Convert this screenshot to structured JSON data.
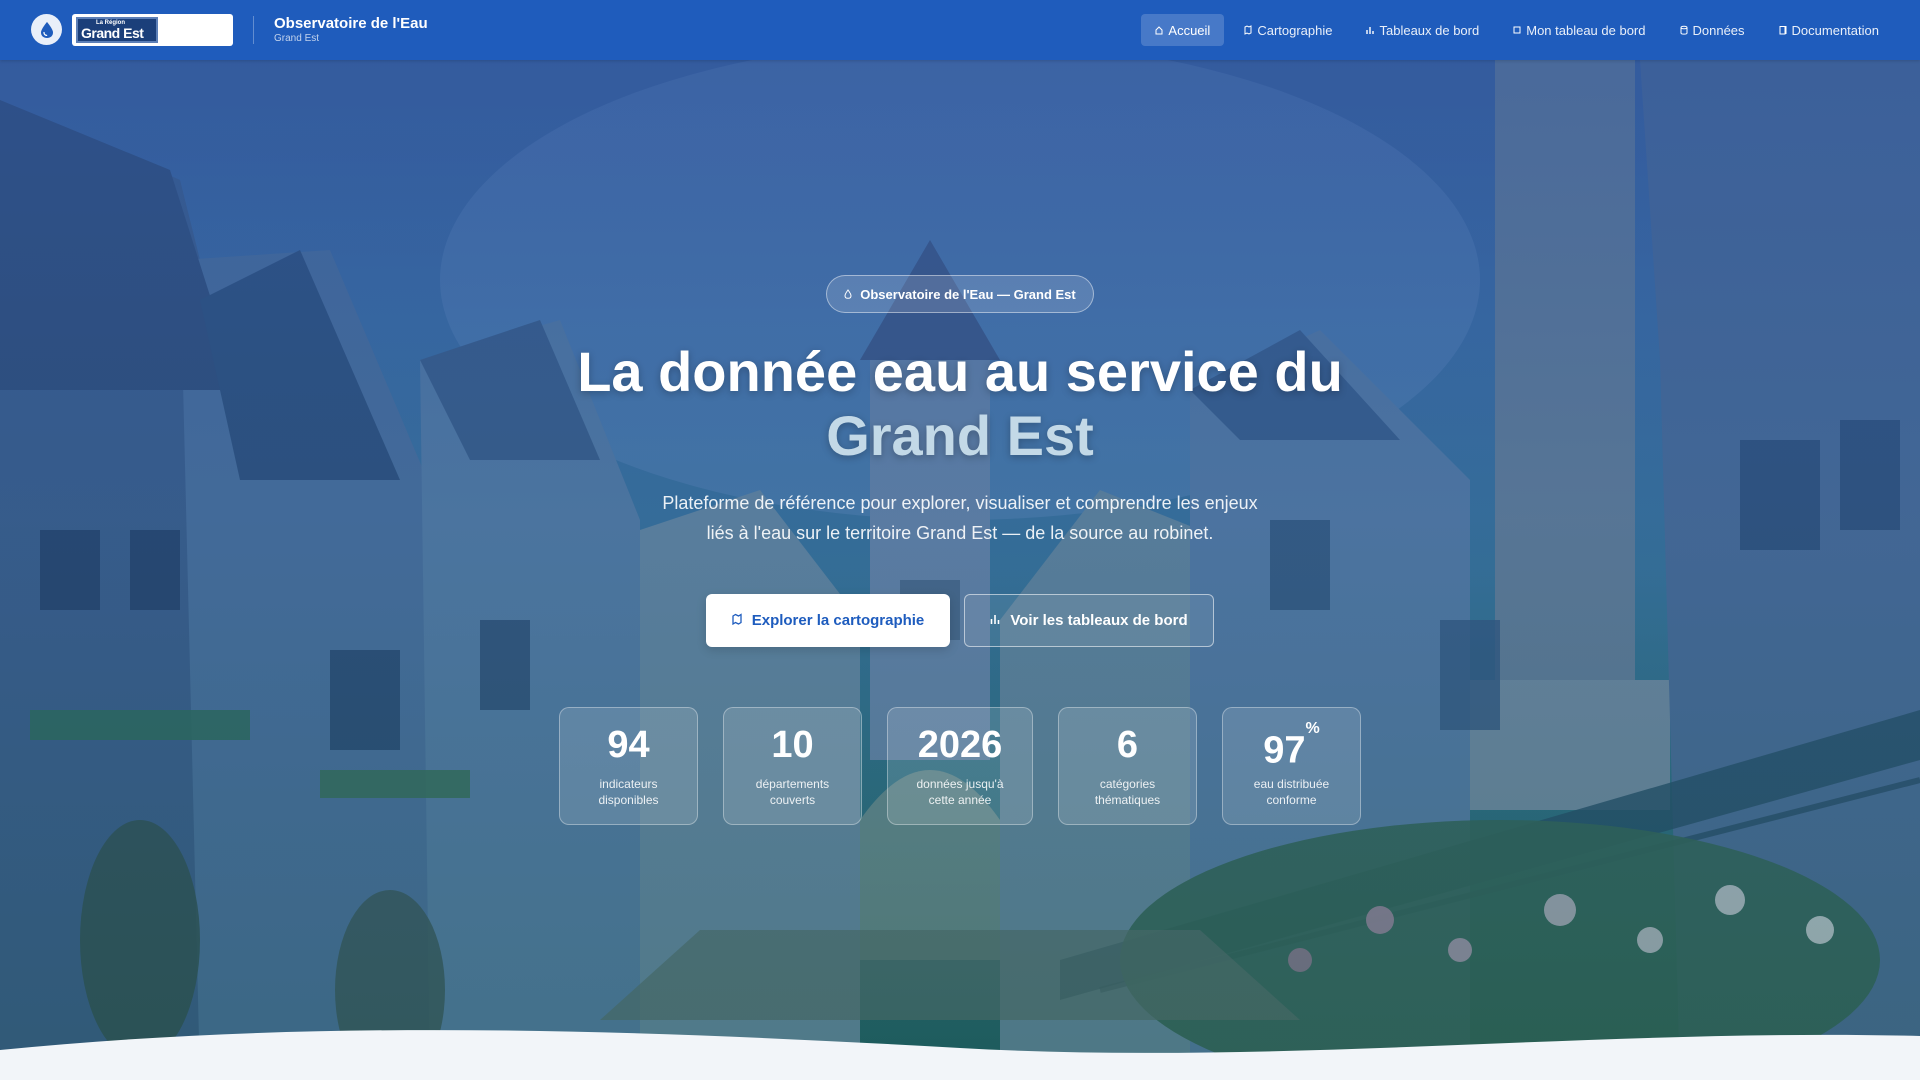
{
  "brand": {
    "logo_small": "La Région",
    "logo_big": "Grand Est",
    "title": "Observatoire de l'Eau",
    "subtitle": "Grand Est",
    "icon": "water-drop-icon"
  },
  "nav": {
    "items": [
      {
        "label": "Accueil",
        "icon": "home-icon",
        "active": true
      },
      {
        "label": "Cartographie",
        "icon": "map-icon"
      },
      {
        "label": "Tableaux de bord",
        "icon": "chart-icon"
      },
      {
        "label": "Mon tableau de bord",
        "icon": "user-dashboard-icon"
      },
      {
        "label": "Données",
        "icon": "database-icon"
      },
      {
        "label": "Documentation",
        "icon": "book-icon"
      }
    ]
  },
  "hero": {
    "pill": "Observatoire de l'Eau — Grand Est",
    "title_line1": "La donnée eau au service du",
    "title_line2": "Grand Est",
    "lead_line1": "Plateforme de référence pour explorer, visualiser et comprendre les enjeux",
    "lead_line2": "liés à l'eau sur le territoire Grand Est — de la source au robinet.",
    "cta_primary": "Explorer la cartographie",
    "cta_secondary": "Voir les tableaux de bord"
  },
  "stats": [
    {
      "value": "94",
      "suffix": "",
      "label_line1": "indicateurs",
      "label_line2": "disponibles"
    },
    {
      "value": "10",
      "suffix": "",
      "label_line1": "départements",
      "label_line2": "couverts"
    },
    {
      "value": "2026",
      "suffix": "",
      "label_line1": "données jusqu'à",
      "label_line2": "cette année"
    },
    {
      "value": "6",
      "suffix": "",
      "label_line1": "catégories",
      "label_line2": "thématiques"
    },
    {
      "value": "97",
      "suffix": "%",
      "label_line1": "eau distribuée",
      "label_line2": "conforme"
    }
  ],
  "colors": {
    "navbar": "#1f5cbc",
    "accent_text": "#c3d9e7",
    "primary_button_text": "#1e5cbe",
    "page_background": "#f2f5f9"
  }
}
